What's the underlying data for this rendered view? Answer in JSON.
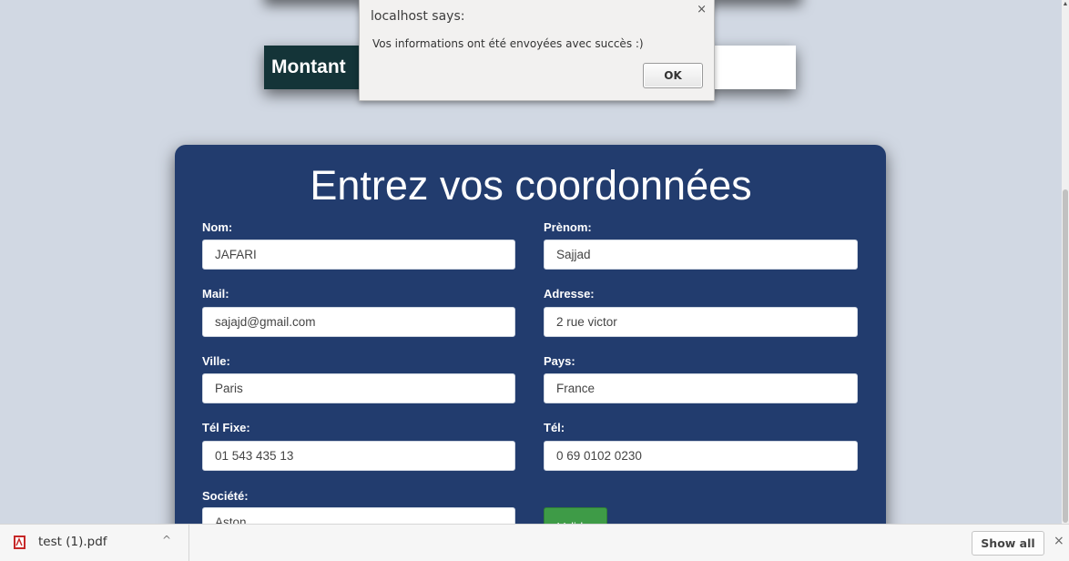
{
  "montant": {
    "label": "Montant",
    "label_color": "#143438"
  },
  "dialog": {
    "title": "localhost says:",
    "message": "Vos informations ont été envoyées avec succès :)",
    "ok_label": "OK",
    "close_glyph": "×"
  },
  "form": {
    "title": "Entrez vos coordonnées",
    "background": "#223c6e",
    "fields": {
      "nom": {
        "label": "Nom:",
        "value": "JAFARI"
      },
      "prenom": {
        "label": "Prènom:",
        "value": "Sajjad"
      },
      "mail": {
        "label": "Mail:",
        "value": "sajajd@gmail.com"
      },
      "adresse": {
        "label": "Adresse:",
        "value": "2 rue victor"
      },
      "ville": {
        "label": "Ville:",
        "value": "Paris"
      },
      "pays": {
        "label": "Pays:",
        "value": "France"
      },
      "tel_fixe": {
        "label": "Tél Fixe:",
        "value": "01 543 435 13"
      },
      "tel": {
        "label": "Tél:",
        "value": "0 69 0102 0230"
      },
      "societe": {
        "label": "Société:",
        "value": "Aston"
      }
    },
    "submit_label": "Valider",
    "submit_color": "#3e9b47"
  },
  "download_bar": {
    "file_name": "test (1).pdf",
    "file_icon": "pdf-file-icon",
    "chevron": "^",
    "show_all_label": "Show all",
    "close_glyph": "×"
  }
}
